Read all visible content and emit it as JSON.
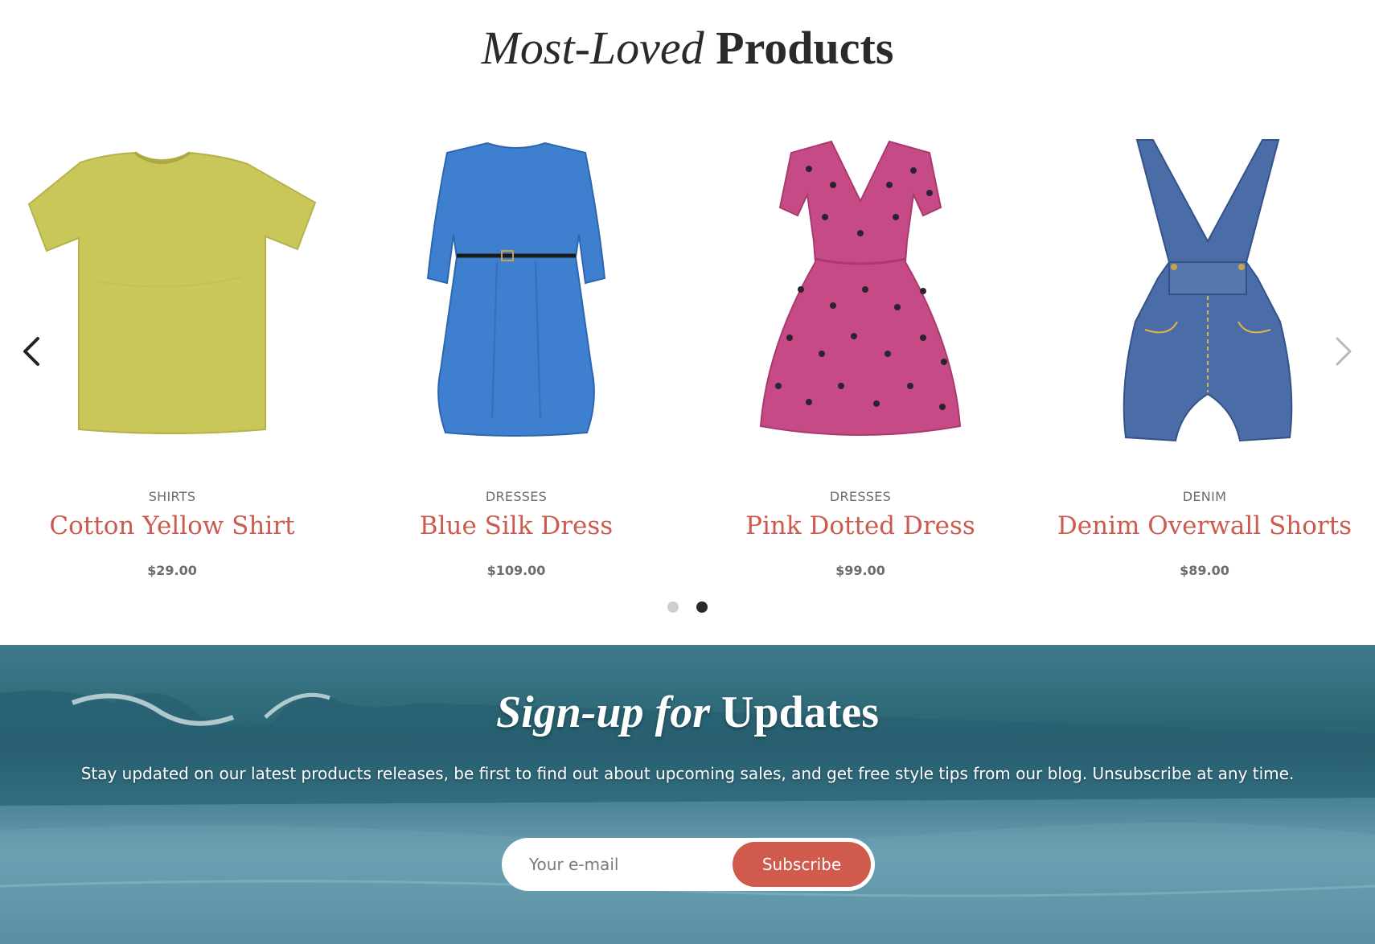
{
  "products_section": {
    "title_italic": "Most-Loved",
    "title_bold": "Products",
    "items": [
      {
        "category": "SHIRTS",
        "name": "Cotton Yellow Shirt",
        "price": "$29.00",
        "image": "yellow-tshirt",
        "color": "#c9c75a"
      },
      {
        "category": "DRESSES",
        "name": "Blue Silk Dress",
        "price": "$109.00",
        "image": "blue-dress",
        "color": "#3f7fcf"
      },
      {
        "category": "DRESSES",
        "name": "Pink Dotted Dress",
        "price": "$99.00",
        "image": "pink-polka-dot-dress",
        "color": "#c64a86"
      },
      {
        "category": "DENIM",
        "name": "Denim Overwall Shorts",
        "price": "$89.00",
        "image": "denim-overalls",
        "color": "#4a6da8"
      }
    ],
    "carousel": {
      "pages": 2,
      "active_page": 2
    }
  },
  "signup": {
    "title_italic": "Sign-up for",
    "title_plain": "Updates",
    "description": "Stay updated on our latest products releases, be first to find out about upcoming sales, and get free style tips from our blog. Unsubscribe at any time.",
    "email_placeholder": "Your e-mail",
    "button_label": "Subscribe"
  },
  "colors": {
    "accent": "#d05b4c",
    "product_name": "#cc5a4e",
    "muted_text": "#6d6d6d",
    "ocean": "#2f6a78"
  }
}
